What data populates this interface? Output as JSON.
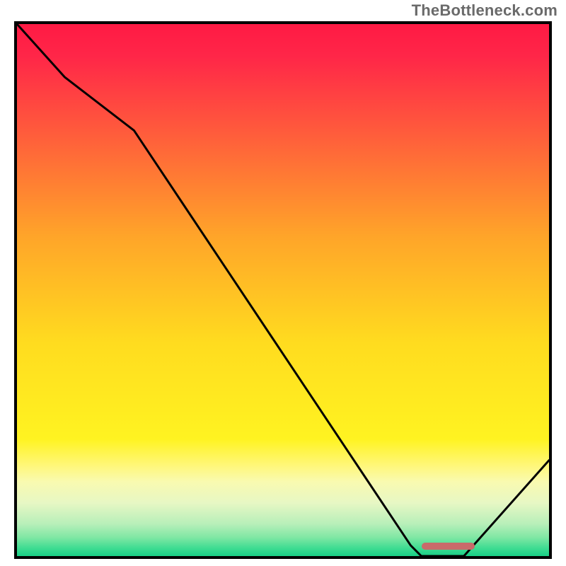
{
  "watermark": "TheBottleneck.com",
  "chart_data": {
    "type": "line",
    "title": "",
    "xlabel": "",
    "ylabel": "",
    "xlim": [
      0,
      100
    ],
    "ylim": [
      0,
      100
    ],
    "grid": false,
    "legend_position": "none",
    "series": [
      {
        "name": "curve",
        "x": [
          0,
          9,
          22,
          74,
          76,
          84,
          100
        ],
        "y": [
          100,
          90,
          80,
          2,
          0,
          0,
          18
        ]
      }
    ],
    "optimal_range_x": [
      76,
      86
    ],
    "gradient": {
      "stops": [
        {
          "offset": 0.0,
          "color": "#ff1a44"
        },
        {
          "offset": 0.06,
          "color": "#ff2648"
        },
        {
          "offset": 0.2,
          "color": "#ff5a3c"
        },
        {
          "offset": 0.4,
          "color": "#ffa529"
        },
        {
          "offset": 0.6,
          "color": "#ffdc1f"
        },
        {
          "offset": 0.78,
          "color": "#fff321"
        },
        {
          "offset": 0.83,
          "color": "#fff77a"
        },
        {
          "offset": 0.86,
          "color": "#f9fab0"
        },
        {
          "offset": 0.9,
          "color": "#e7f7c4"
        },
        {
          "offset": 0.94,
          "color": "#b7efb9"
        },
        {
          "offset": 0.965,
          "color": "#7fe7a4"
        },
        {
          "offset": 0.985,
          "color": "#3fdc92"
        },
        {
          "offset": 1.0,
          "color": "#18cf86"
        }
      ]
    }
  }
}
